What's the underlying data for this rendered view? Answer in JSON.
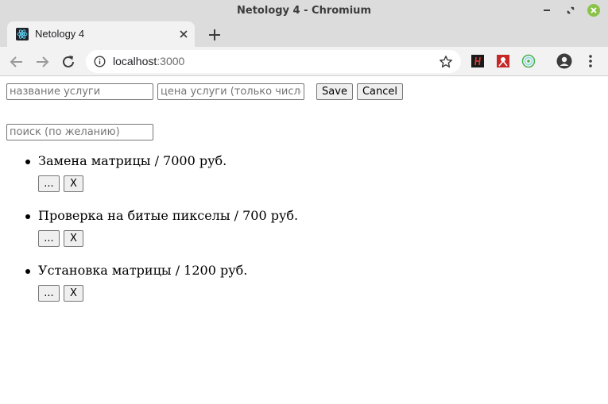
{
  "window": {
    "title": "Netology 4 - Chromium"
  },
  "tab": {
    "title": "Netology 4"
  },
  "address_bar": {
    "host": "localhost",
    "port": ":3000"
  },
  "form": {
    "name_placeholder": "название услуги",
    "price_placeholder": "цена услуги (только число)",
    "save_label": "Save",
    "cancel_label": "Cancel"
  },
  "search": {
    "placeholder": "поиск (по желанию)"
  },
  "services": [
    {
      "text": "Замена матрицы / 7000 руб.",
      "edit_label": "...",
      "delete_label": "X"
    },
    {
      "text": "Проверка на битые пикселы / 700 руб.",
      "edit_label": "...",
      "delete_label": "X"
    },
    {
      "text": "Установка матрицы / 1200 руб.",
      "edit_label": "...",
      "delete_label": "X"
    }
  ],
  "colors": {
    "titlebar": "#dcdcdc",
    "toolbar": "#f2f2f2",
    "window_control_close": "#8bc34a",
    "react_logo": "#61dafb"
  },
  "icons": [
    "minimize-icon",
    "restore-icon",
    "close-window-icon",
    "react-favicon-icon",
    "close-tab-icon",
    "plus-icon",
    "back-arrow-icon",
    "forward-arrow-icon",
    "reload-icon",
    "info-icon",
    "star-icon",
    "extension-h-icon",
    "extension-red-icon",
    "extension-green-icon",
    "profile-icon",
    "kebab-menu-icon"
  ]
}
